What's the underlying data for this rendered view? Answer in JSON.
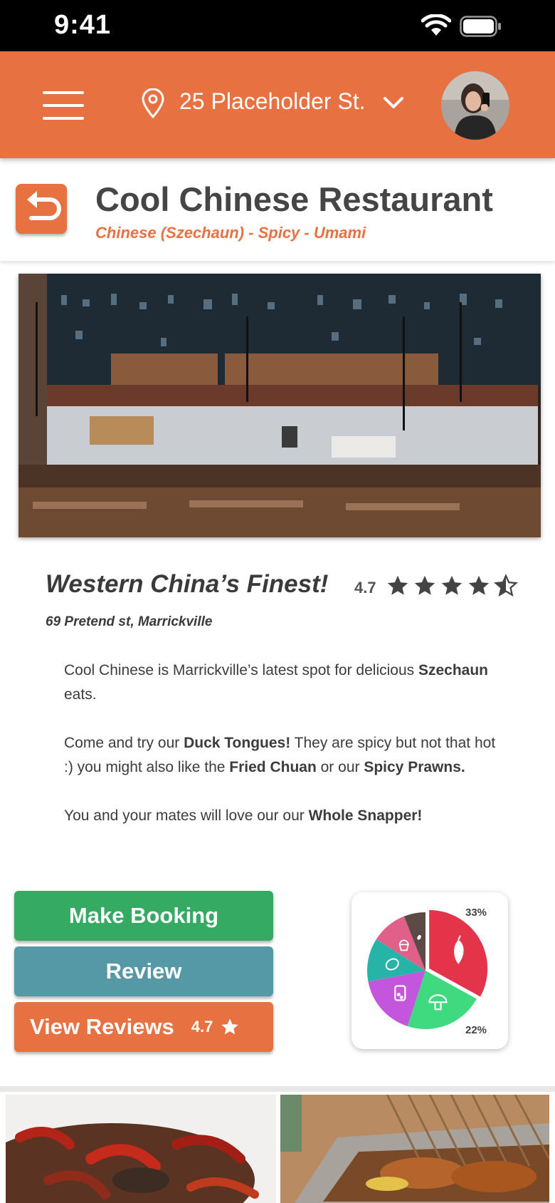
{
  "status_bar": {
    "time": "9:41"
  },
  "top_bar": {
    "location": "25 Placeholder St."
  },
  "restaurant": {
    "name": "Cool Chinese Restaurant",
    "subtitle": "Chinese (Szechaun) - Spicy - Umami",
    "tagline": "Western China’s Finest!",
    "rating": "4.7",
    "rating_value": 4.7,
    "address": "69 Pretend st, Marrickville"
  },
  "description": {
    "p1_a": "Cool Chinese is Marrickville’s latest spot for delicious ",
    "p1_b": "Szechaun",
    "p1_c": " eats.",
    "p2_a": "Come and try our ",
    "p2_b": "Duck Tongues!",
    "p2_c": " They are spicy but not that hot :) you might also like the ",
    "p2_d": "Fried Chuan",
    "p2_e": " or our ",
    "p2_f": "Spicy Prawns.",
    "p3_a": "You and your mates will love our our ",
    "p3_b": "Whole Snapper!"
  },
  "buttons": {
    "booking": "Make Booking",
    "review": "Review",
    "view_reviews": "View Reviews",
    "view_reviews_rating": "4.7"
  },
  "flavour_chart": {
    "label_top": "33%",
    "label_bottom": "22%",
    "segments": [
      {
        "icon": "chili-icon",
        "percent": 33,
        "color": "#e4344a"
      },
      {
        "icon": "mushroom-icon",
        "percent": 22,
        "color": "#3fd97f"
      },
      {
        "icon": "salt-shaker-icon",
        "percent": 17,
        "color": "#c456dd"
      },
      {
        "icon": "lemon-icon",
        "percent": 12,
        "color": "#26b3a8"
      },
      {
        "icon": "cupcake-icon",
        "percent": 10,
        "color": "#e0608a"
      },
      {
        "icon": "bean-icon",
        "percent": 6,
        "color": "#5d4a47"
      }
    ]
  },
  "colors": {
    "brand": "#e87142",
    "booking": "#34aa62",
    "review": "#5598a6"
  }
}
